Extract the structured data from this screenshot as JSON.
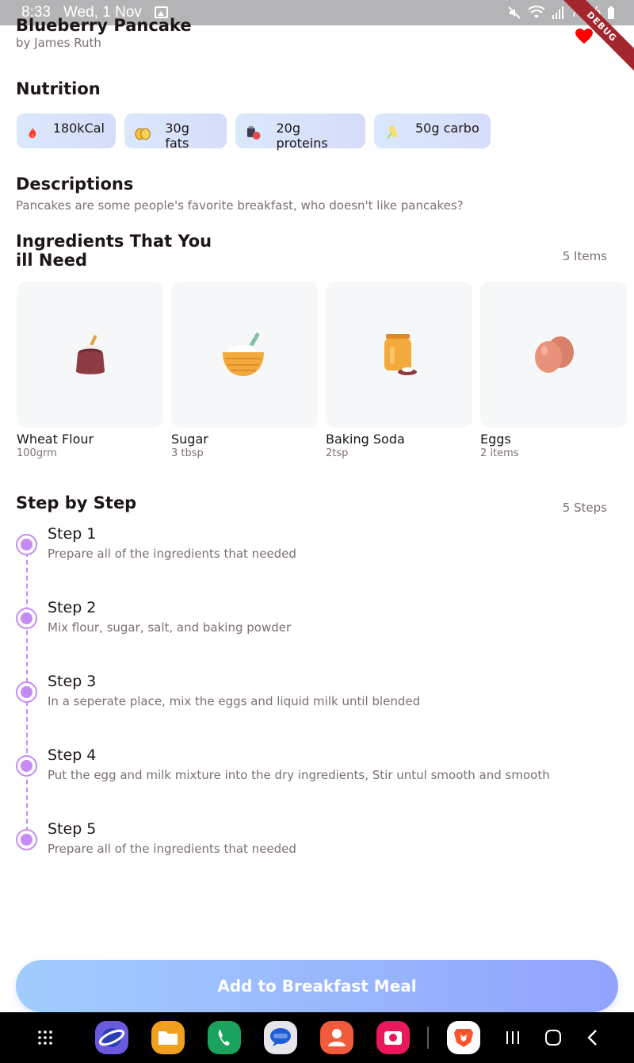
{
  "status_bar": {
    "time": "8:33",
    "date": "Wed, 1 Nov",
    "battery": "79%"
  },
  "debug_banner": "DEBUG",
  "header": {
    "title": "Blueberry Pancake",
    "author": "by James Ruth",
    "favorite_color": "#ff0000"
  },
  "nutrition": {
    "title": "Nutrition",
    "chips": [
      {
        "label": "180kCal",
        "icon": "flame-icon"
      },
      {
        "label": "30g fats",
        "icon": "egg-icon"
      },
      {
        "label": "20g proteins",
        "icon": "proteins-icon"
      },
      {
        "label": "50g carbo",
        "icon": "corn-icon"
      }
    ]
  },
  "description": {
    "title": "Descriptions",
    "text": "Pancakes are some people's favorite breakfast, who doesn't like pancakes?"
  },
  "ingredients": {
    "title_line1": "Ingredients That You",
    "title_line2": "ill Need",
    "count": "5 Items",
    "items": [
      {
        "name": "Wheat Flour",
        "qty": "100grm",
        "icon": "flour-sack-icon"
      },
      {
        "name": "Sugar",
        "qty": "3 tbsp",
        "icon": "sugar-bowl-icon"
      },
      {
        "name": "Baking Soda",
        "qty": "2tsp",
        "icon": "baking-soda-jar-icon"
      },
      {
        "name": "Eggs",
        "qty": "2 items",
        "icon": "eggs-icon"
      }
    ]
  },
  "steps": {
    "title": "Step by Step",
    "count": "5 Steps",
    "items": [
      {
        "title": "Step 1",
        "desc": "Prepare all of the ingredients that needed"
      },
      {
        "title": "Step 2",
        "desc": "Mix flour, sugar, salt, and baking powder"
      },
      {
        "title": "Step 3",
        "desc": "In a seperate place, mix the eggs and liquid milk until blended"
      },
      {
        "title": "Step 4",
        "desc": "Put the egg and milk mixture into the dry ingredients, Stir untul smooth and smooth"
      },
      {
        "title": "Step 5",
        "desc": "Prepare all of the ingredients that needed"
      }
    ]
  },
  "cta": {
    "label": "Add to Breakfast Meal"
  },
  "colors": {
    "accent_purple": "#c58bf2",
    "button_gradient_start": "#a1cdfd",
    "button_gradient_end": "#92a3fd"
  },
  "nav_bar": {
    "apps": [
      "apps-grid-icon",
      "internet-browser-icon",
      "files-icon",
      "phone-icon",
      "messages-icon",
      "contacts-icon",
      "camera-icon",
      "brave-browser-icon"
    ],
    "system": [
      "recents-icon",
      "home-icon",
      "back-icon"
    ]
  }
}
